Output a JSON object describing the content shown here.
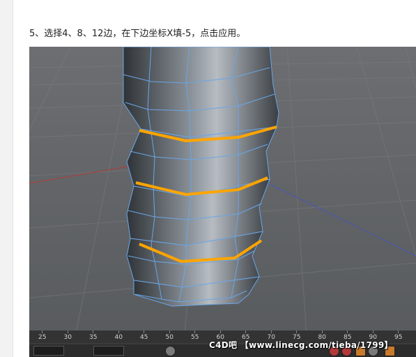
{
  "page": {
    "instruction": "5、选择4、8、12边，在下边坐标X填-5，点击应用。"
  },
  "viewport": {
    "background_color": "#5f6164",
    "mesh_color": "#9aa4ad",
    "wire_color": "#6aa6e8",
    "selected_edge_color": "#ffa500"
  },
  "timeline": {
    "ticks": [
      "25",
      "30",
      "35",
      "40",
      "45",
      "50",
      "55",
      "60",
      "65",
      "70",
      "75",
      "80",
      "85",
      "90",
      "95"
    ]
  },
  "watermark": {
    "text": "C4D吧 【www.linecg.com/tieba/1799】"
  }
}
